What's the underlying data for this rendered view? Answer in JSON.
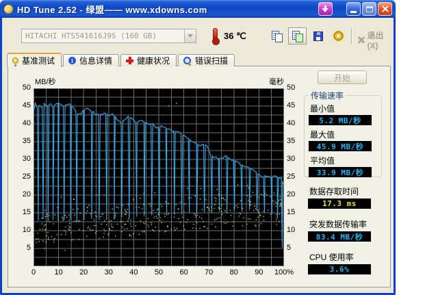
{
  "window": {
    "title": "HD Tune 2.52 - 绿盟—— www.xdowns.com"
  },
  "titlebar": {
    "buttons": [
      "download",
      "minimize",
      "maximize",
      "close"
    ]
  },
  "toolbar": {
    "drive_select": {
      "value": "HITACHI HTS541616J9S (160 GB)",
      "disabled": true
    },
    "temperature": {
      "value": "36",
      "unit": "℃"
    },
    "buttons": [
      {
        "name": "copy",
        "framed": false
      },
      {
        "name": "copy-image",
        "framed": true
      },
      {
        "name": "save",
        "framed": false
      },
      {
        "name": "options",
        "framed": false
      }
    ],
    "exit_label": "退出(X)"
  },
  "tabs": [
    {
      "label": "基准测试",
      "icon": "lightbulb",
      "active": true
    },
    {
      "label": "信息详情",
      "icon": "info",
      "active": false
    },
    {
      "label": "健康状况",
      "icon": "health-cross",
      "active": false
    },
    {
      "label": "错误扫描",
      "icon": "magnifier",
      "active": false
    }
  ],
  "panel": {
    "start_button": "开始",
    "group_title": "传输速率",
    "stats": [
      {
        "label": "最小值",
        "value": "5.2 MB/秒",
        "color": "cyan"
      },
      {
        "label": "最大值",
        "value": "45.9 MB/秒",
        "color": "cyan"
      },
      {
        "label": "平均值",
        "value": "33.9 MB/秒",
        "color": "cyan"
      }
    ],
    "extra_stats": [
      {
        "label": "数据存取时间",
        "value": "17.3 ms",
        "color": "yellow"
      },
      {
        "label": "突发数据传输率",
        "value": "83.4 MB/秒",
        "color": "cyan"
      },
      {
        "label": "CPU 使用率",
        "value": "3.6%",
        "color": "cyan"
      }
    ]
  },
  "chart_data": {
    "type": "line+scatter",
    "title": "HD Tune benchmark: transfer rate line (left axis) + access time scatter (right axis)",
    "x_axis": {
      "range": [
        0,
        100
      ],
      "tick_labels": [
        "0",
        "10",
        "20",
        "30",
        "40",
        "50",
        "60",
        "70",
        "80",
        "90",
        "100%"
      ],
      "grid_step": 5
    },
    "left_axis": {
      "label": "MB/秒",
      "range": [
        0,
        50
      ],
      "ticks": [
        50,
        45,
        40,
        35,
        30,
        25,
        20,
        15,
        10,
        5
      ],
      "grid_step": 2.5
    },
    "right_axis": {
      "label": "毫秒",
      "range": [
        0,
        50
      ],
      "ticks": [
        50,
        45,
        40,
        35,
        30,
        25,
        20,
        15,
        10,
        5
      ]
    },
    "colors": {
      "plot_bg": "#000000",
      "grid": "#7B7B7B",
      "line": "#3AAAE8",
      "scatter": "#DDE877"
    },
    "summary_stats": {
      "min_mb_s": 5.2,
      "max_mb_s": 45.9,
      "avg_mb_s": 33.9,
      "access_time_ms": 17.3,
      "burst_rate_mb_s": 83.4,
      "cpu_usage_pct": 3.6
    },
    "series": [
      {
        "name": "transfer_rate_mb_s",
        "type": "line",
        "axis": "left",
        "sample_step": 0.7,
        "noise_amplitude": 0.35,
        "baseline": [
          [
            0,
            43.2
          ],
          [
            0.7,
            45.7
          ],
          [
            1.5,
            44.3
          ],
          [
            2.5,
            45.4
          ],
          [
            3.2,
            44.1
          ],
          [
            4.2,
            45.8
          ],
          [
            5.5,
            45.1
          ],
          [
            6.5,
            45.6
          ],
          [
            8,
            44.7
          ],
          [
            9,
            45.6
          ],
          [
            10.5,
            45.8
          ],
          [
            12,
            44.9
          ],
          [
            13,
            45.5
          ],
          [
            14.5,
            45.6
          ],
          [
            16,
            44.3
          ],
          [
            17,
            43.5
          ],
          [
            18,
            42.5
          ],
          [
            19,
            43.1
          ],
          [
            20,
            43.9
          ],
          [
            21.5,
            44.2
          ],
          [
            23,
            43.6
          ],
          [
            24.5,
            43.0
          ],
          [
            26,
            42.7
          ],
          [
            28,
            42.8
          ],
          [
            30,
            42.7
          ],
          [
            31.5,
            42.6
          ],
          [
            33,
            41.8
          ],
          [
            34,
            40.9
          ],
          [
            35,
            40.3
          ],
          [
            36.5,
            41.5
          ],
          [
            38,
            42.0
          ],
          [
            39.5,
            41.2
          ],
          [
            41,
            40.2
          ],
          [
            42.5,
            40.9
          ],
          [
            44,
            40.6
          ],
          [
            45.5,
            39.9
          ],
          [
            47,
            40.1
          ],
          [
            48.5,
            39.3
          ],
          [
            50,
            38.8
          ],
          [
            51.5,
            39.4
          ],
          [
            53,
            38.9
          ],
          [
            54.5,
            38.2
          ],
          [
            56,
            37.6
          ],
          [
            57.5,
            38.0
          ],
          [
            59,
            37.2
          ],
          [
            60.5,
            36.3
          ],
          [
            62,
            35.8
          ],
          [
            63.5,
            35.1
          ],
          [
            65,
            34.6
          ],
          [
            66.5,
            33.8
          ],
          [
            68,
            34.1
          ],
          [
            69.5,
            33.4
          ],
          [
            71,
            31.0
          ],
          [
            72.5,
            30.4
          ],
          [
            74,
            30.2
          ],
          [
            75.5,
            30.6
          ],
          [
            77,
            30.9
          ],
          [
            78.5,
            30.2
          ],
          [
            80,
            29.8
          ],
          [
            81.5,
            29.1
          ],
          [
            83,
            28.4
          ],
          [
            84.5,
            27.7
          ],
          [
            86,
            27.9
          ],
          [
            87.5,
            27.0
          ],
          [
            89,
            26.4
          ],
          [
            90.5,
            25.6
          ],
          [
            92,
            25.0
          ],
          [
            93.5,
            25.6
          ],
          [
            95,
            25.1
          ],
          [
            96.5,
            25.3
          ],
          [
            98,
            25.0
          ],
          [
            99.2,
            24.8
          ],
          [
            100,
            22.0
          ]
        ],
        "spikes": [
          [
            1.9,
            12.8
          ],
          [
            3.8,
            13.2
          ],
          [
            5.8,
            12.6
          ],
          [
            7.8,
            13.0
          ],
          [
            9.8,
            12.7
          ],
          [
            12.2,
            12.9
          ],
          [
            14.8,
            13.1
          ],
          [
            17.3,
            12.6
          ],
          [
            20.2,
            13.0
          ],
          [
            23.2,
            13.3
          ],
          [
            26.2,
            12.9
          ],
          [
            29.2,
            13.4
          ],
          [
            32.2,
            13.1
          ],
          [
            35.2,
            13.8
          ],
          [
            38.2,
            13.4
          ],
          [
            41.2,
            13.9
          ],
          [
            44.2,
            14.1
          ],
          [
            47.2,
            14.3
          ],
          [
            50.2,
            14.0
          ],
          [
            53.2,
            14.4
          ],
          [
            56.2,
            14.8
          ],
          [
            59.2,
            14.5
          ],
          [
            62.2,
            15.0
          ],
          [
            65.2,
            14.7
          ],
          [
            68.2,
            15.2
          ],
          [
            71.2,
            15.0
          ],
          [
            74.2,
            15.4
          ],
          [
            77.2,
            15.1
          ],
          [
            80.2,
            15.7
          ],
          [
            83.2,
            15.3
          ],
          [
            86.2,
            15.8
          ],
          [
            89.2,
            15.5
          ],
          [
            92.2,
            15.1
          ],
          [
            95.2,
            14.6
          ],
          [
            97.4,
            13.8
          ],
          [
            99.3,
            5.2
          ]
        ]
      },
      {
        "name": "access_time_ms",
        "type": "scatter",
        "axis": "right",
        "band": {
          "count": 380,
          "center_start": 11,
          "center_end": 16.5,
          "spread": 4.5,
          "y_min": 6.2,
          "y_max": 23,
          "seed": 1234
        },
        "outliers": [
          [
            53.8,
            45.2
          ],
          [
            56.9,
            45.9
          ],
          [
            12.5,
            4.6
          ],
          [
            4.2,
            5.2
          ]
        ]
      }
    ]
  }
}
